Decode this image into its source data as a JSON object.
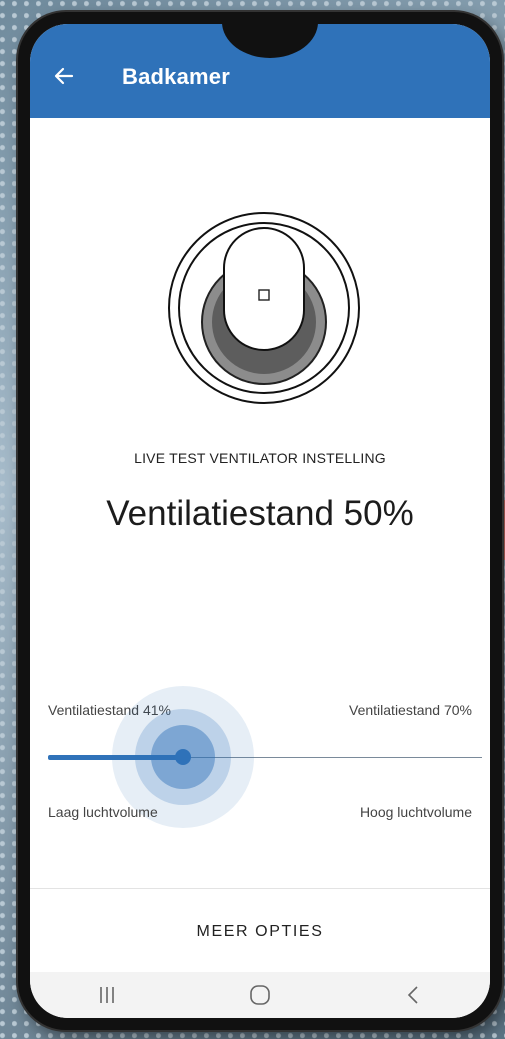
{
  "header": {
    "title": "Badkamer",
    "back_icon": "arrow-left-icon"
  },
  "device": {
    "icon": "ventilator-dial-icon"
  },
  "status": {
    "caption": "LIVE TEST VENTILATOR INSTELLING",
    "value_text": "Ventilatiestand 50%"
  },
  "slider": {
    "min_label": "Ventilatiestand 41%",
    "max_label": "Ventilatiestand 70%",
    "low_label": "Laag luchtvolume",
    "high_label": "Hoog luchtvolume",
    "position_fraction": 0.31
  },
  "actions": {
    "more_label": "MEER OPTIES"
  },
  "navbar": {
    "recent_icon": "recent-apps-icon",
    "home_icon": "home-icon",
    "back_icon": "back-icon"
  },
  "colors": {
    "accent": "#2f72b9",
    "background": "#ffffff",
    "navbar": "#f3f3f3"
  }
}
